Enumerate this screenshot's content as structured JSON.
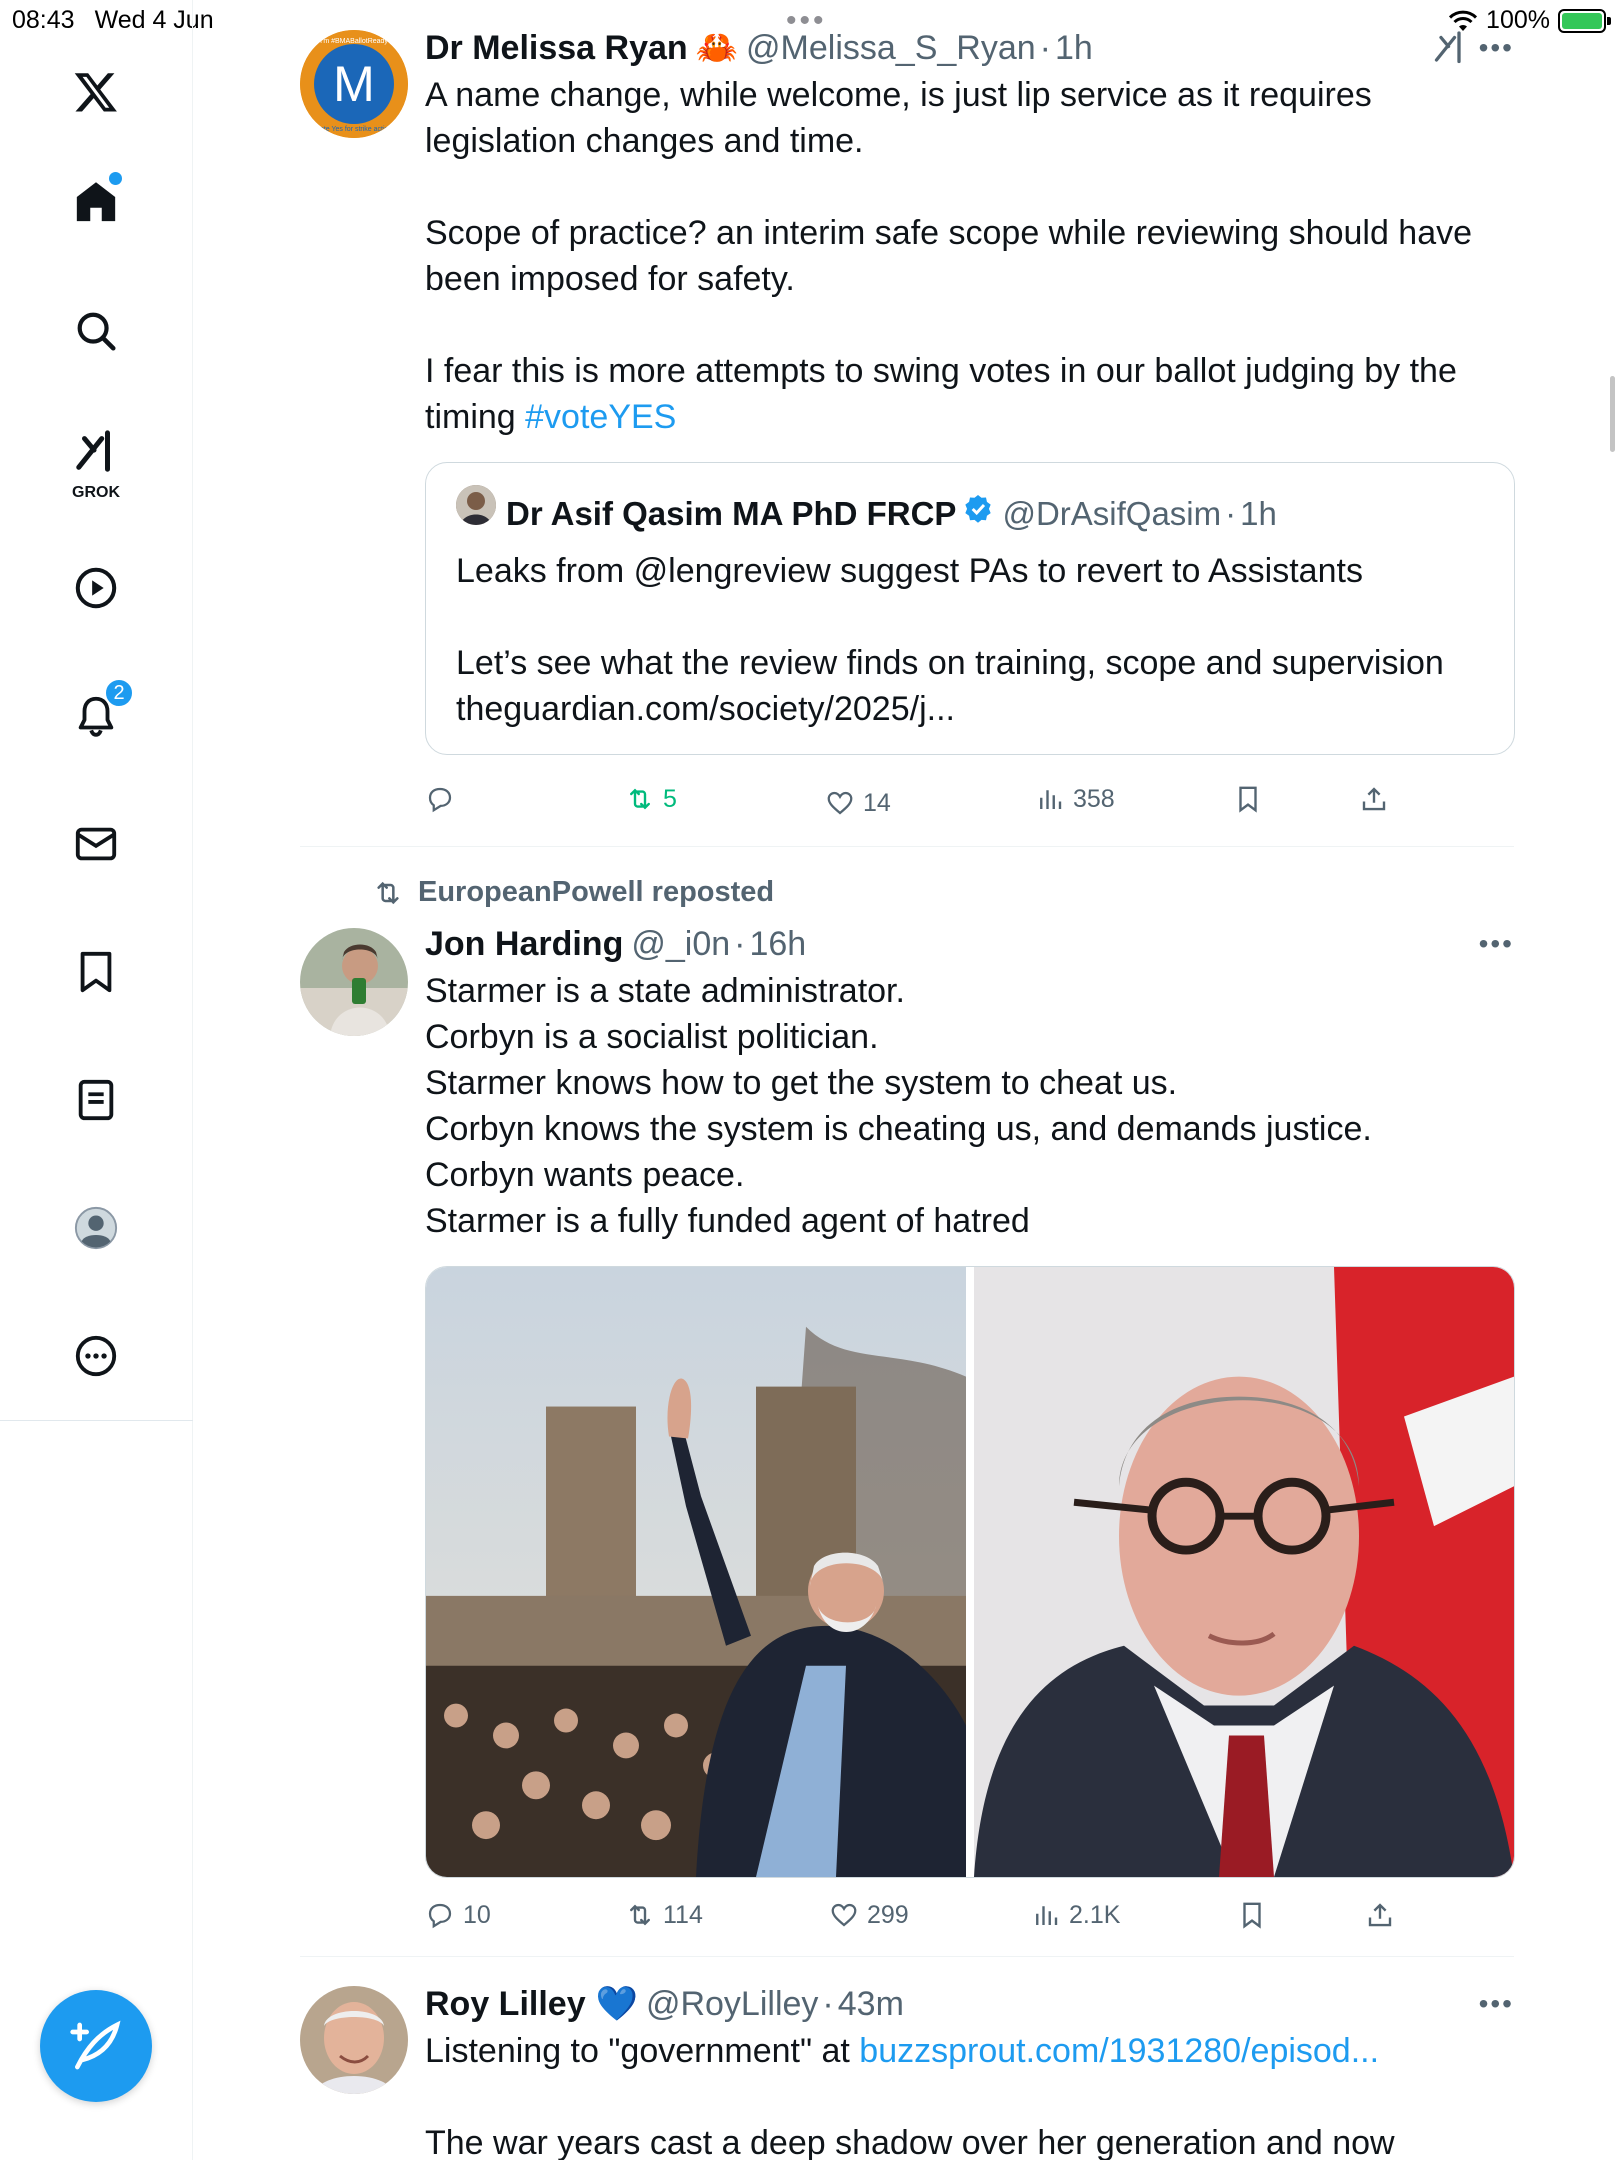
{
  "status": {
    "time": "08:43",
    "date": "Wed 4 Jun",
    "battery": "100%"
  },
  "sidebar": {
    "items": [
      "x-logo",
      "home",
      "search",
      "grok",
      "video",
      "notifications",
      "messages",
      "bookmarks",
      "lists",
      "profile",
      "more"
    ],
    "grok_label": "GROK",
    "notifications_count": "2"
  },
  "tweets": [
    {
      "name": "Dr Melissa Ryan",
      "name_emoji": "🦀",
      "handle": "@Melissa_S_Ryan",
      "time": "1h",
      "avatar_letter": "M",
      "avatar_ring_text_top": "I'm #BMABallotReady",
      "avatar_ring_text_bottom": "Vote Yes for strike action",
      "text": "A name change, while welcome, is just lip service as it requires legislation changes and time.\n\nScope of practice? an interim safe scope while reviewing should have been imposed for safety.\n\nI fear this is more attempts to swing votes in our ballot judging by the timing ",
      "hashtag": "#voteYES",
      "quote": {
        "name": "Dr Asif Qasim MA PhD FRCP",
        "handle": "@DrAsifQasim",
        "time": "1h",
        "text": "Leaks from @lengreview suggest PAs to revert to Assistants\n\nLet’s see what the review finds on training, scope and supervision\ntheguardian.com/society/2025/j..."
      },
      "actions": {
        "replies": "",
        "reposts": "5",
        "likes": "14",
        "views": "358"
      }
    },
    {
      "reposted_by": "EuropeanPowell reposted",
      "name": "Jon Harding",
      "handle": "@_i0n",
      "time": "16h",
      "text": "Starmer is a state administrator.\nCorbyn is a socialist politician.\nStarmer knows how to get the system to cheat us.\nCorbyn knows the system is cheating us, and demands justice.\nCorbyn wants peace.\nStarmer is a fully funded agent of hatred",
      "actions": {
        "replies": "10",
        "reposts": "114",
        "likes": "299",
        "views": "2.1K"
      }
    },
    {
      "name": "Roy Lilley",
      "name_emoji": "💙",
      "handle": "@RoyLilley",
      "time": "43m",
      "text_prefix": "Listening to \"government\" at ",
      "link": "buzzsprout.com/1931280/episod...",
      "text_2": "The war years cast a deep shadow over her generation and now"
    }
  ],
  "colors": {
    "accent": "#1d9bf0",
    "repost_green": "#00ba7c",
    "text": "#0f1419",
    "secondary": "#536471"
  },
  "ui": {
    "sep": "·"
  }
}
